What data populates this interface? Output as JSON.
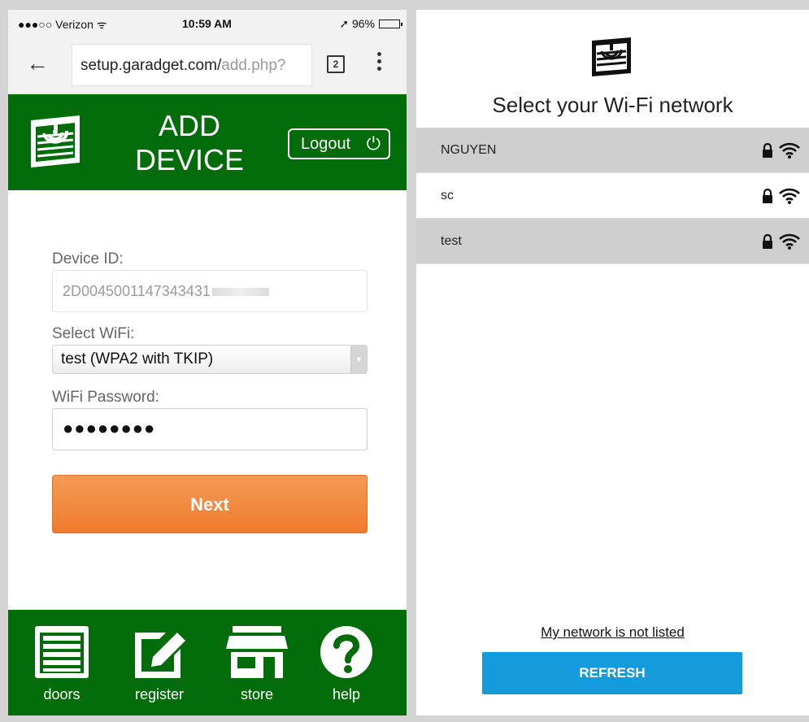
{
  "left_phone": {
    "status_bar": {
      "carrier": "●●●○○ Verizon ᯤ",
      "time": "10:59 AM",
      "battery": "➚ 96%"
    },
    "browser": {
      "url_main": "setup.garadget.com/",
      "url_dim": "add.php?",
      "tab_count": "2"
    },
    "header": {
      "title": "ADD DEVICE",
      "logout_label": "Logout",
      "power_glyph": "⏻"
    },
    "form": {
      "device_id_label": "Device ID:",
      "device_id_value": "2D0045001147343431",
      "wifi_label": "Select WiFi:",
      "wifi_selected": "test (WPA2 with TKIP)",
      "password_label": "WiFi Password:",
      "password_value": "●●●●●●●●",
      "next_label": "Next"
    },
    "footer": {
      "items": [
        {
          "label": "doors"
        },
        {
          "label": "register"
        },
        {
          "label": "store"
        },
        {
          "label": "help"
        }
      ]
    }
  },
  "right_phone": {
    "title": "Select your Wi-Fi network",
    "networks": [
      {
        "name": "NGUYEN"
      },
      {
        "name": "sc"
      },
      {
        "name": "test"
      }
    ],
    "not_listed": "My network is not listed",
    "refresh": "REFRESH"
  },
  "colors": {
    "brand_green": "#026c0a",
    "next_orange": "#ef7b2c",
    "refresh_blue": "#149bdc"
  }
}
